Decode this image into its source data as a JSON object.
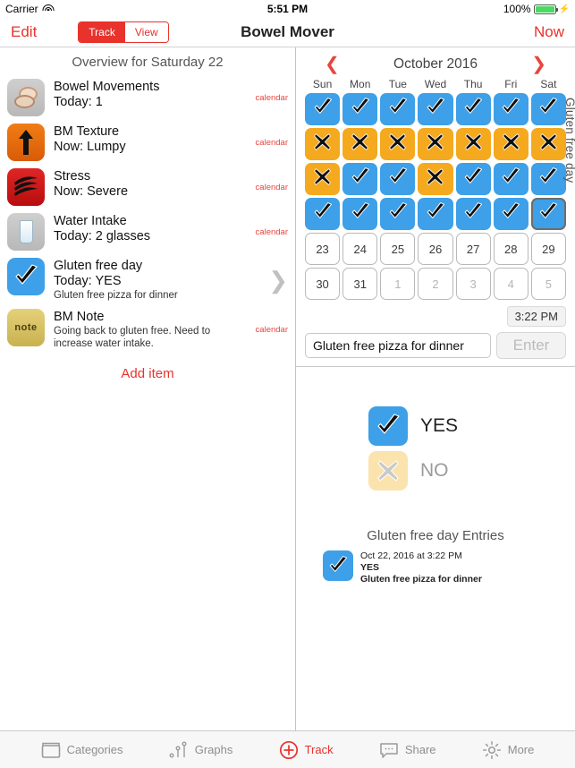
{
  "statusbar": {
    "carrier": "Carrier",
    "wifi_icon": "wifi-icon",
    "time": "5:51 PM",
    "battery_percent": "100%",
    "battery_icon": "battery-icon",
    "charging_icon": "lightning-bolt-icon"
  },
  "navbar": {
    "edit_label": "Edit",
    "segmented": {
      "track_label": "Track",
      "view_label": "View",
      "selected": "Track"
    },
    "title": "Bowel Mover",
    "now_label": "Now"
  },
  "left": {
    "overview_title": "Overview for Saturday 22",
    "calendar_link_label": "calendar",
    "add_item_label": "Add item",
    "items": [
      {
        "icon": "toilet-icon",
        "title": "Bowel Movements",
        "subtitle": "Today: 1",
        "note": "",
        "accessory": "calendar"
      },
      {
        "icon": "up-arrow-icon",
        "title": "BM Texture",
        "subtitle": "Now: Lumpy",
        "note": "",
        "accessory": "calendar"
      },
      {
        "icon": "stress-lines-icon",
        "title": "Stress",
        "subtitle": "Now: Severe",
        "note": "",
        "accessory": "calendar"
      },
      {
        "icon": "water-glass-icon",
        "title": "Water Intake",
        "subtitle": "Today: 2 glasses",
        "note": "",
        "accessory": "calendar"
      },
      {
        "icon": "checkmark-icon",
        "title": "Gluten free day",
        "subtitle": "Today: YES",
        "note": "Gluten free pizza for dinner",
        "accessory": "chevron"
      },
      {
        "icon": "note-icon",
        "title": "BM Note",
        "subtitle": "",
        "note": "Going back to gluten free. Need to increase water intake.",
        "accessory": "calendar"
      }
    ]
  },
  "calendar": {
    "month_label": "October 2016",
    "prev_icon": "chevron-left-icon",
    "next_icon": "chevron-right-icon",
    "vertical_label": "Gluten free day",
    "day_headers": [
      "Sun",
      "Mon",
      "Tue",
      "Wed",
      "Thu",
      "Fri",
      "Sat"
    ],
    "weeks": [
      [
        {
          "state": "check"
        },
        {
          "state": "check"
        },
        {
          "state": "check"
        },
        {
          "state": "check"
        },
        {
          "state": "check"
        },
        {
          "state": "check"
        },
        {
          "state": "check"
        }
      ],
      [
        {
          "state": "cross"
        },
        {
          "state": "cross"
        },
        {
          "state": "cross"
        },
        {
          "state": "cross"
        },
        {
          "state": "cross"
        },
        {
          "state": "cross"
        },
        {
          "state": "cross"
        }
      ],
      [
        {
          "state": "cross"
        },
        {
          "state": "check"
        },
        {
          "state": "check"
        },
        {
          "state": "cross"
        },
        {
          "state": "check"
        },
        {
          "state": "check"
        },
        {
          "state": "check"
        }
      ],
      [
        {
          "state": "check"
        },
        {
          "state": "check"
        },
        {
          "state": "check"
        },
        {
          "state": "check"
        },
        {
          "state": "check"
        },
        {
          "state": "check"
        },
        {
          "state": "check",
          "selected": true
        }
      ],
      [
        {
          "state": "num",
          "num": "23"
        },
        {
          "state": "num",
          "num": "24"
        },
        {
          "state": "num",
          "num": "25"
        },
        {
          "state": "num",
          "num": "26"
        },
        {
          "state": "num",
          "num": "27"
        },
        {
          "state": "num",
          "num": "28"
        },
        {
          "state": "num",
          "num": "29"
        }
      ],
      [
        {
          "state": "num",
          "num": "30"
        },
        {
          "state": "num",
          "num": "31"
        },
        {
          "state": "num",
          "num": "1",
          "dim": true
        },
        {
          "state": "num",
          "num": "2",
          "dim": true
        },
        {
          "state": "num",
          "num": "3",
          "dim": true
        },
        {
          "state": "num",
          "num": "4",
          "dim": true
        },
        {
          "state": "num",
          "num": "5",
          "dim": true
        }
      ]
    ]
  },
  "entry": {
    "time_label": "3:22 PM",
    "note_value": "Gluten free pizza for dinner",
    "note_placeholder": "",
    "enter_label": "Enter"
  },
  "choices": {
    "yes_label": "YES",
    "no_label": "NO",
    "selected": "YES",
    "yes_icon": "checkmark-icon",
    "no_icon": "cross-icon"
  },
  "entries": {
    "title": "Gluten free day Entries",
    "rows": [
      {
        "icon": "checkmark-icon",
        "timestamp": "Oct 22, 2016 at 3:22 PM",
        "value": "YES",
        "note": "Gluten free pizza for dinner"
      }
    ]
  },
  "tabbar": {
    "active": "Track",
    "tabs": [
      {
        "label": "Categories",
        "icon": "box-icon"
      },
      {
        "label": "Graphs",
        "icon": "scatter-graph-icon"
      },
      {
        "label": "Track",
        "icon": "plus-circle-icon"
      },
      {
        "label": "Share",
        "icon": "speech-bubble-icon"
      },
      {
        "label": "More",
        "icon": "gear-icon"
      }
    ]
  },
  "colors": {
    "accent_red": "#E8322B",
    "check_blue": "#3DA0E8",
    "cross_amber": "#F5A91E",
    "no_amber_light": "#FBE3AD"
  }
}
